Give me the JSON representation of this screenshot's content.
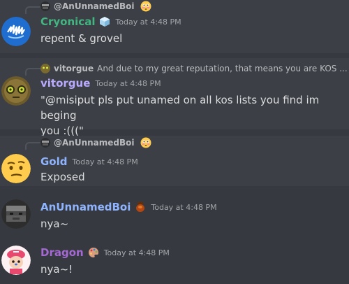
{
  "messages": [
    {
      "reply_to": {
        "name": "@AnUnnamedBoi"
      },
      "author": {
        "name": "Cryonical",
        "color": "#43b581"
      },
      "timestamp": "Today at 4:48 PM",
      "text": "repent & grovel"
    },
    {
      "reply_to": {
        "name": "vitorgue",
        "text": "And due to my great reputation, that means you are KOS ..."
      },
      "author": {
        "name": "vitorgue",
        "color": "#b9a9ff"
      },
      "timestamp": "Today at 4:48 PM",
      "text": "\"@misiput pls put unamed on all kos lists you find im beging\nyou :(((\""
    },
    {
      "reply_to": {
        "name": "@AnUnnamedBoi"
      },
      "author": {
        "name": "Gold",
        "color": "#8fb4ff"
      },
      "timestamp": "Today at 4:48 PM",
      "text": "Exposed"
    },
    {
      "author": {
        "name": "AnUnnamedBoi",
        "color": "#8fb4ff"
      },
      "timestamp": "Today at 4:48 PM",
      "text": "nya~"
    },
    {
      "author": {
        "name": "Dragon",
        "color": "#a569d4"
      },
      "timestamp": "Today at 4:48 PM",
      "text": "nya~!"
    }
  ]
}
